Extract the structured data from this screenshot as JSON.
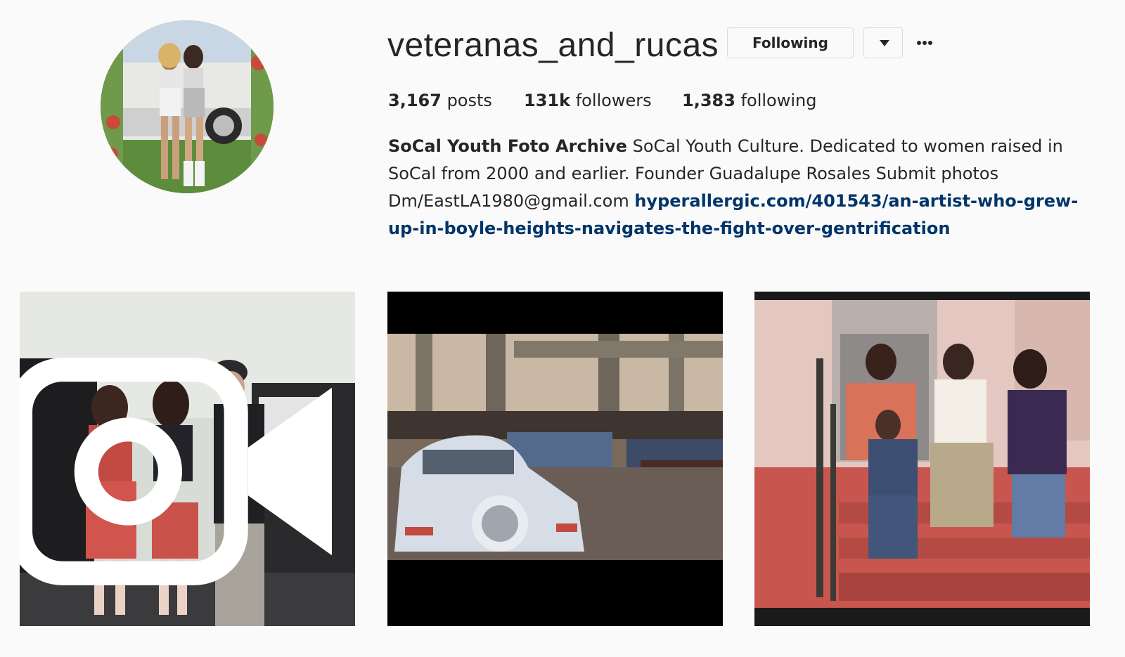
{
  "profile": {
    "username": "veteranas_and_rucas",
    "following_label": "Following"
  },
  "stats": {
    "posts_count": "3,167",
    "posts_label": "posts",
    "followers_count": "131k",
    "followers_label": "followers",
    "following_count": "1,383",
    "following_label": "following"
  },
  "bio": {
    "name": "SoCal Youth Foto Archive",
    "text": "SoCal Youth Culture. Dedicated to women raised in SoCal from 2000 and earlier. Founder Guadalupe Rosales Submit photos Dm/EastLA1980@gmail.com",
    "link": "hyperallergic.com/401543/an-artist-who-grew-up-in-boyle-heights-navigates-the-fight-over-gentrification"
  },
  "posts": [
    {
      "kind": "video",
      "icon": "video-camera-icon"
    },
    {
      "kind": "photo"
    },
    {
      "kind": "photo"
    }
  ],
  "icons": {
    "dropdown": "triangle-down-icon",
    "more": "ellipsis-icon"
  },
  "colors": {
    "background": "#fafafa",
    "text": "#262626",
    "link": "#003569",
    "border": "#dbdbdb"
  }
}
